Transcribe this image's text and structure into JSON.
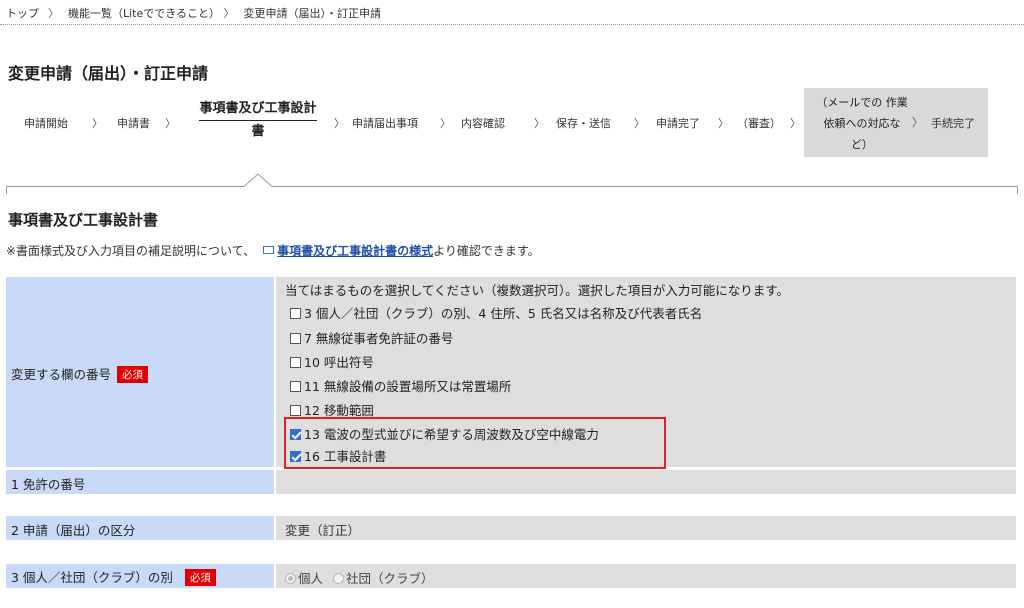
{
  "breadcrumb": {
    "items": [
      "トップ",
      "機能一覧（Liteでできること）",
      "変更申請（届出）・訂正申請"
    ],
    "separator": "〉"
  },
  "page_title": "変更申請（届出）・訂正申請",
  "steps": {
    "s1": "申請開始",
    "s2": "申請書",
    "current_line1": "事項書及び工事設計",
    "current_line2": "書",
    "s4": "申請届出事項",
    "s5": "内容確認",
    "s6": "保存・送信",
    "s7": "申請完了",
    "s8": "（審査）",
    "gray_line1": "（メールでの 作業",
    "gray_line2": "依頼への対応な",
    "gray_line3": "ど）",
    "gray_last": "手続完了",
    "arrow": "〉"
  },
  "section_title": "事項書及び工事設計書",
  "note": {
    "before": "※書面様式及び入力項目の補足説明について、",
    "link": "事項書及び工事設計書の様式",
    "after": "より確認できます。"
  },
  "required_label": "必須",
  "change_fields": {
    "label": "変更する欄の番号",
    "instruction": "当てはまるものを選択してください（複数選択可）。選択した項目が入力可能になります。",
    "options": [
      {
        "label": "3 個人／社団（クラブ）の別、4 住所、5 氏名又は名称及び代表者氏名",
        "checked": false
      },
      {
        "label": "7 無線従事者免許証の番号",
        "checked": false
      },
      {
        "label": "10 呼出符号",
        "checked": false
      },
      {
        "label": "11 無線設備の設置場所又は常置場所",
        "checked": false
      },
      {
        "label": "12 移動範囲",
        "checked": false
      },
      {
        "label": "13 電波の型式並びに希望する周波数及び空中線電力",
        "checked": true
      },
      {
        "label": "16 工事設計書",
        "checked": true
      }
    ]
  },
  "row_license": {
    "label": "1 免許の番号",
    "value": ""
  },
  "row_category": {
    "label": "2 申請（届出）の区分",
    "value": "変更（訂正）"
  },
  "row_type": {
    "label": "3 個人／社団（クラブ）の別",
    "options": [
      {
        "label": "個人",
        "selected": true
      },
      {
        "label": "社団（クラブ）",
        "selected": false
      }
    ]
  },
  "colors": {
    "label_bg": "#c9daf8",
    "value_bg": "#dedede",
    "required_bg": "#e00000",
    "highlight_border": "#e02020",
    "link": "#1f4fa8"
  }
}
